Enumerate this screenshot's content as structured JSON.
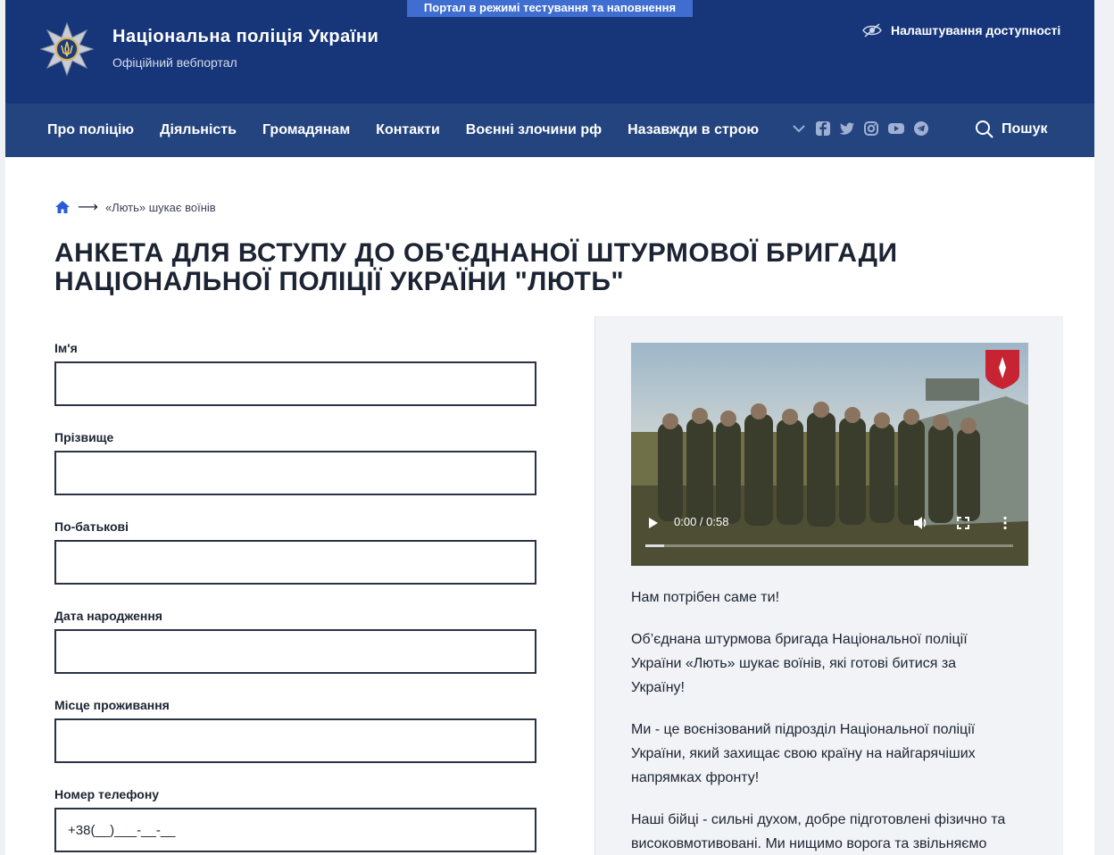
{
  "test_banner": "Портал в режимі тестування та наповнення",
  "brand": {
    "title": "Національна поліція України",
    "subtitle": "Офіційний вебпортал"
  },
  "accessibility_label": "Налаштування доступності",
  "nav": {
    "items": [
      "Про поліцію",
      "Діяльність",
      "Громадянам",
      "Контакти",
      "Воєнні злочини рф",
      "Назавжди в строю"
    ],
    "search_label": "Пошук",
    "social_icons": [
      "chevron-down-icon",
      "facebook-icon",
      "twitter-icon",
      "instagram-icon",
      "youtube-icon",
      "telegram-icon"
    ]
  },
  "breadcrumb": {
    "current": "«Лють» шукає воїнів"
  },
  "page_title": "АНКЕТА ДЛЯ ВСТУПУ ДО ОБ'ЄДНАНОЇ ШТУРМОВОЇ БРИГАДИ НАЦІОНАЛЬНОЇ ПОЛІЦІЇ УКРАЇНИ \"ЛЮТЬ\"",
  "form": {
    "fields": [
      {
        "label": "Ім'я",
        "value": ""
      },
      {
        "label": "Прізвище",
        "value": ""
      },
      {
        "label": "По-батькові",
        "value": ""
      },
      {
        "label": "Дата народження",
        "value": ""
      },
      {
        "label": "Місце проживання",
        "value": ""
      },
      {
        "label": "Номер телефону",
        "value": "+38(__)___-__-__"
      }
    ]
  },
  "video": {
    "time": "0:00 / 0:58",
    "progress": 0.05
  },
  "panel": {
    "paragraphs": [
      "Нам потрібен саме ти!",
      "Об’єднана штурмова бригада Національної поліції України «Лють» шукає воїнів, які готові битися за Україну!",
      "Ми - це воєнізований підрозділ Національної поліції України, який захищає свою країну на найгарячіших напрямках фронту!",
      "Наші бійці - сильні духом, добре підготовлені фізично та високовмотивовані. Ми нищимо ворога та звільняємо"
    ]
  },
  "colors": {
    "header_bg": "#17367a",
    "nav_bg": "#24447f",
    "banner_bg": "#3f6ed0"
  }
}
